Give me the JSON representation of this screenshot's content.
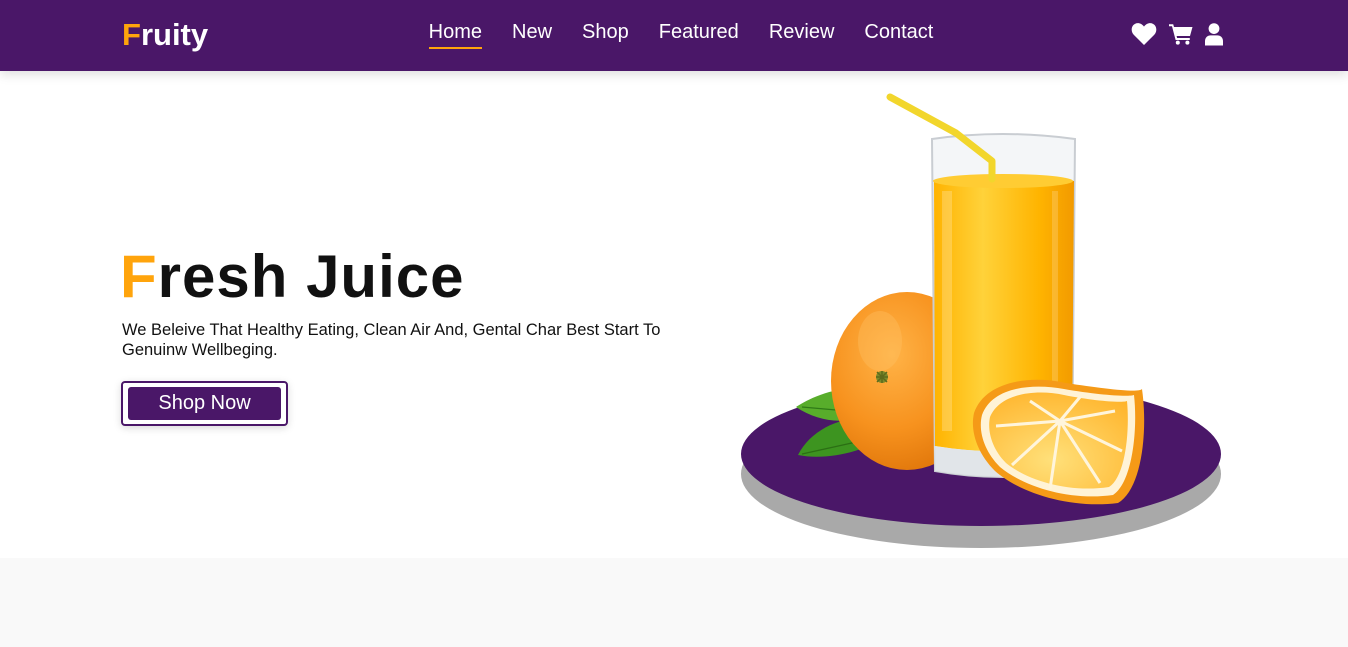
{
  "brand": {
    "first_letter": "F",
    "rest": "ruity"
  },
  "nav": {
    "links": [
      {
        "label": "Home",
        "active": true
      },
      {
        "label": "New",
        "active": false
      },
      {
        "label": "Shop",
        "active": false
      },
      {
        "label": "Featured",
        "active": false
      },
      {
        "label": "Review",
        "active": false
      },
      {
        "label": "Contact",
        "active": false
      }
    ],
    "icons": [
      "heart-icon",
      "cart-icon",
      "user-icon"
    ]
  },
  "hero": {
    "title_first_letter": "F",
    "title_rest": "resh Juice",
    "description": "We Beleive That Healthy Eating, Clean Air And, Gental Char Best Start To Genuinw Wellbeging.",
    "cta_label": "Shop Now"
  },
  "colors": {
    "primary": "#4a1768",
    "accent": "#ffa40c",
    "text": "#111111",
    "background": "#ffffff",
    "lower_section": "#f9f9f9"
  }
}
